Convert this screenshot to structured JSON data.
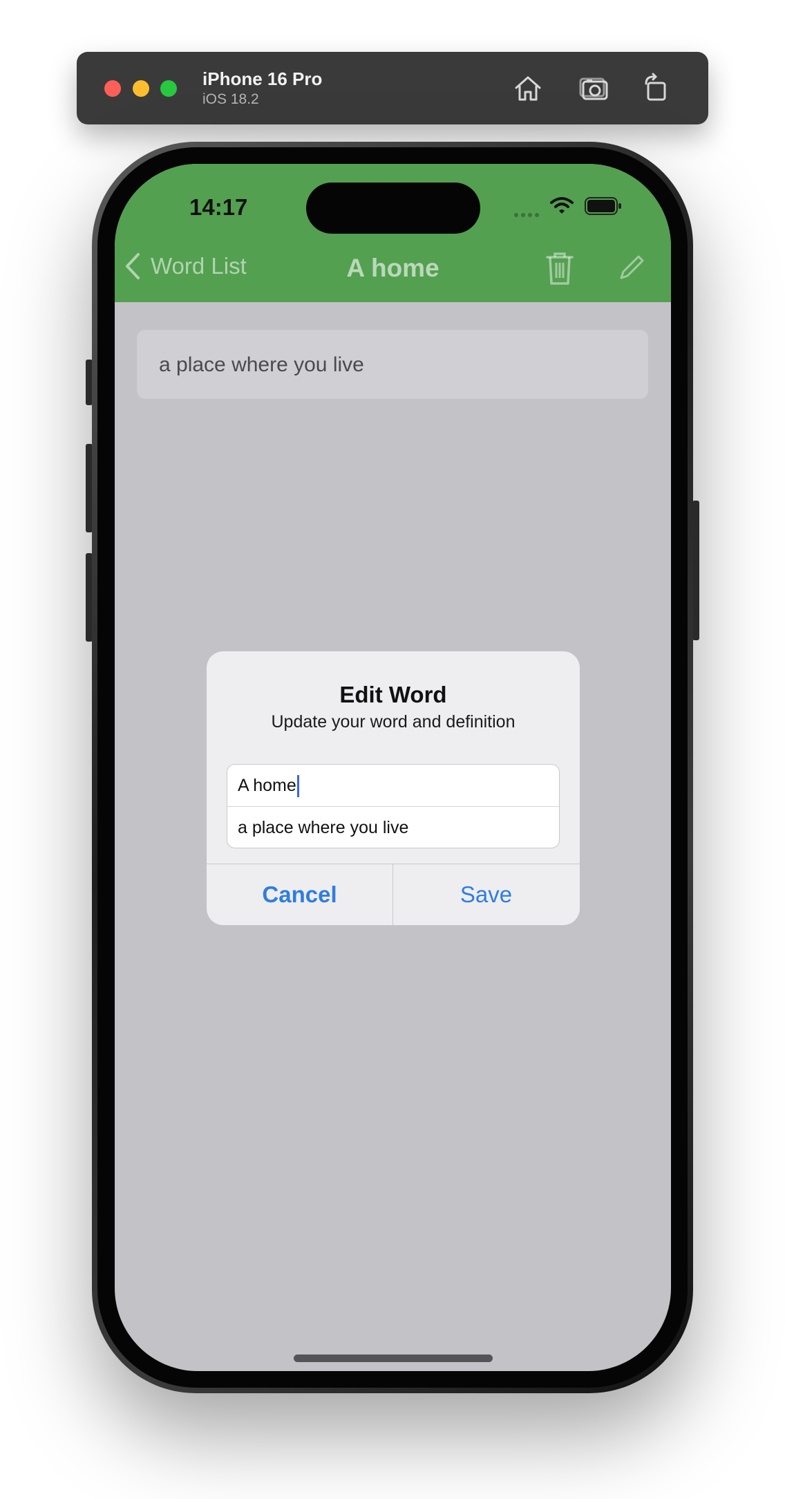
{
  "simulator": {
    "device_name": "iPhone 16 Pro",
    "os_version": "iOS 18.2",
    "toolbar_icons": [
      "home-icon",
      "screenshot-icon",
      "rotate-icon"
    ]
  },
  "status_bar": {
    "time": "14:17"
  },
  "nav_bar": {
    "back_label": "Word List",
    "title": "A home",
    "background_color": "#53a050",
    "right_icons": [
      "trash-icon",
      "pencil-icon"
    ]
  },
  "content": {
    "definition": "a place where you live"
  },
  "alert": {
    "title": "Edit Word",
    "message": "Update your word and definition",
    "word_value": "A home",
    "definition_value": "a place where you live",
    "cancel_label": "Cancel",
    "save_label": "Save",
    "button_color": "#2f7de1"
  }
}
